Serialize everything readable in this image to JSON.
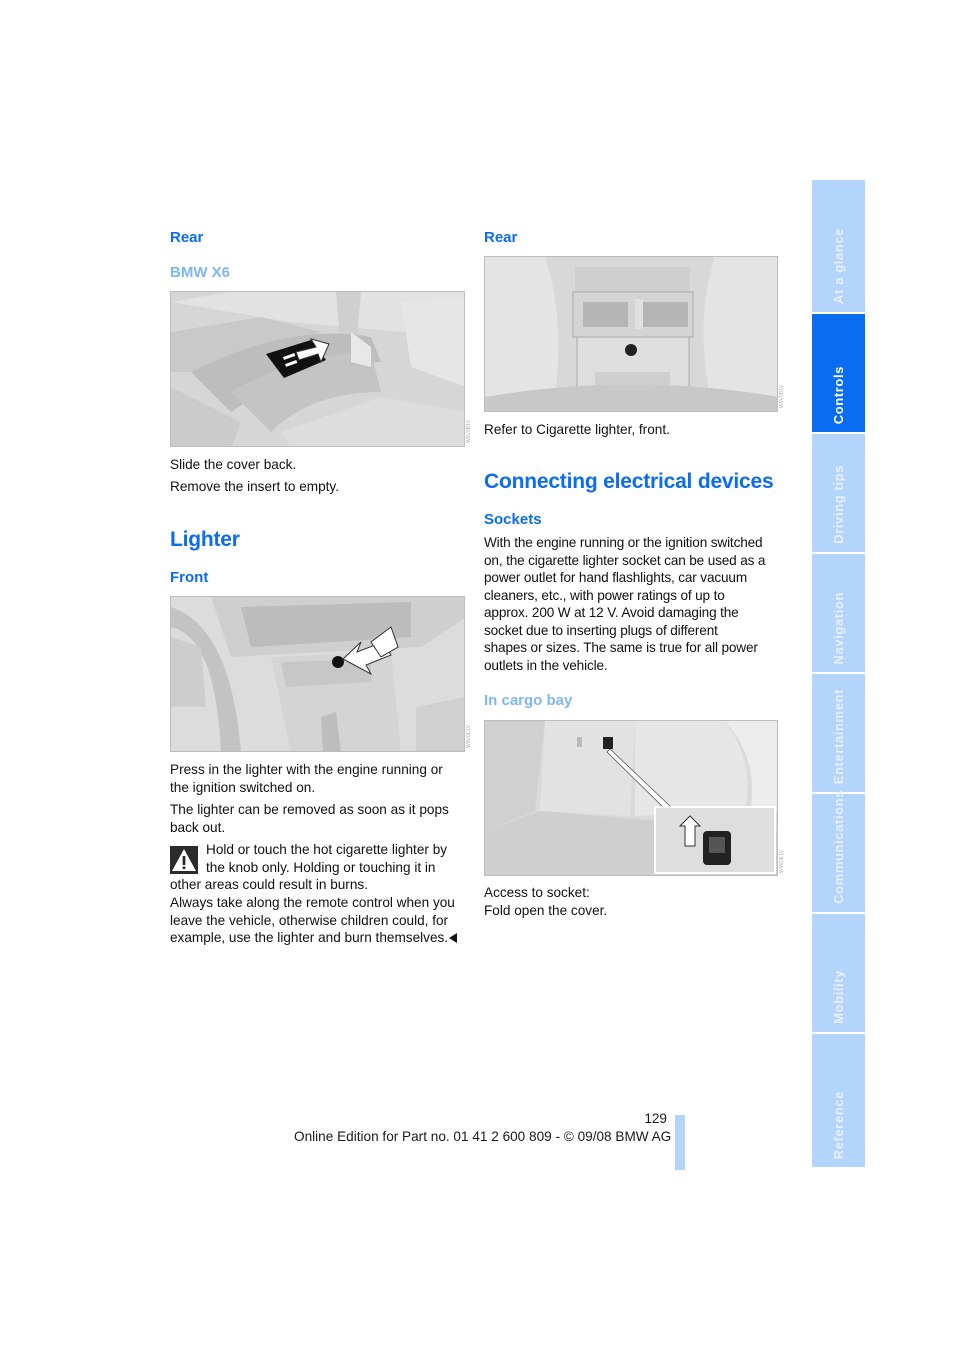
{
  "left_column": {
    "rear_heading": "Rear",
    "model_heading": "BMW X6",
    "figure1_code": "W9V0B1V",
    "steps": [
      "Slide the cover back.",
      "Remove the insert to empty."
    ],
    "lighter_heading": "Lighter",
    "front_heading": "Front",
    "figure2_code": "W9V0C1V",
    "press_text": "Press in the lighter with the engine running or the ignition switched on.",
    "press_line1": "Press in the lighter with the engine running or",
    "press_line2": "the ignition switched on.",
    "removed_line1": "The lighter can be removed as soon as it pops",
    "removed_line2": "back out.",
    "warning": {
      "icon": "warning-triangle-icon",
      "line1": "Hold or touch the hot cigarette lighter by",
      "line2": "the knob only. Holding or touching it in",
      "line3": "other areas could result in burns.",
      "line4": "Always take along the remote control when you",
      "line5": "leave the vehicle, otherwise children could, for",
      "line6": "example, use the lighter and burn themselves."
    }
  },
  "right_column": {
    "rear_heading": "Rear",
    "figure3_code": "W9V0D1V",
    "refer_text": "Refer to Cigarette lighter, front.",
    "section_heading": "Connecting electrical devices",
    "sockets_heading": "Sockets",
    "sockets_lines": [
      "With the engine running or the ignition switched",
      "on, the cigarette lighter socket can be used as a",
      "power outlet for hand flashlights, car vacuum",
      "cleaners, etc., with power ratings of up to",
      "approx. 200 W at 12 V. Avoid damaging the",
      "socket due to inserting plugs of different",
      "shapes or sizes. The same is true for all power",
      "outlets in the vehicle."
    ],
    "cargo_heading": "In cargo bay",
    "figure4_code": "W9V0E1V",
    "access_line1": "Access to socket:",
    "access_line2": "Fold open the cover."
  },
  "side_tabs": [
    {
      "label": "At a glance",
      "active": false
    },
    {
      "label": "Controls",
      "active": true
    },
    {
      "label": "Driving tips",
      "active": false
    },
    {
      "label": "Navigation",
      "active": false
    },
    {
      "label": "Entertainment",
      "active": false
    },
    {
      "label": "Communications",
      "active": false
    },
    {
      "label": "Mobility",
      "active": false
    },
    {
      "label": "Reference",
      "active": false
    }
  ],
  "footer": {
    "page_number": "129",
    "edition_text": "Online Edition for Part no. 01 41 2 600 809 - © 09/08 BMW AG"
  },
  "colors": {
    "heading_blue": "#0a6cf0",
    "light_blue": "#7fb6f5",
    "tab_inactive": "#b3d4fb",
    "tab_active": "#0a6cf0"
  }
}
